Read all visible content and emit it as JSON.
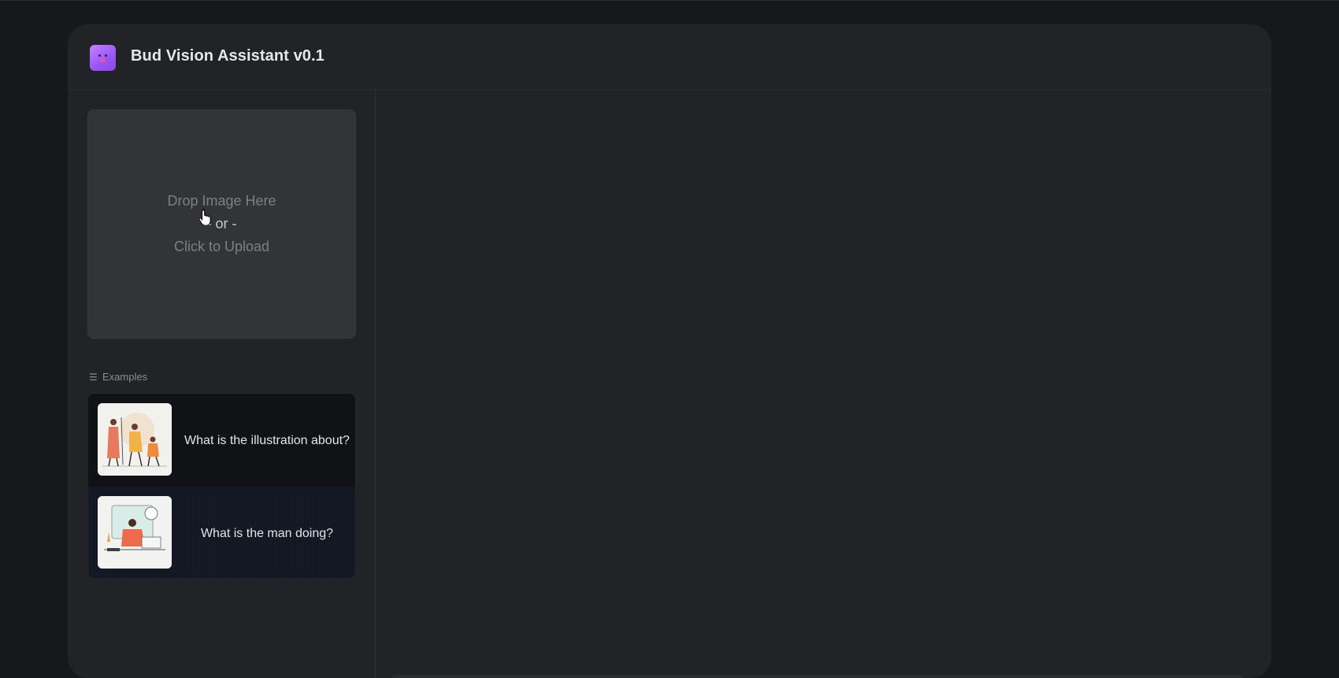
{
  "app": {
    "title": "Bud Vision Assistant v0.1",
    "logo_icon": "smiley-face-icon"
  },
  "upload": {
    "line1": "Drop Image Here",
    "line2": "- or -",
    "line3": "Click to Upload"
  },
  "examples": {
    "label": "Examples",
    "label_icon": "list-icon",
    "items": [
      {
        "text": "What is the illustration about?",
        "thumbnail": "illustration-people-walking"
      },
      {
        "text": "What is the man doing?",
        "thumbnail": "illustration-man-at-laptop"
      }
    ]
  },
  "colors": {
    "background": "#17181b",
    "panel": "#222326",
    "upload_bg": "#333437",
    "accent_logo": "#9a55f5"
  }
}
